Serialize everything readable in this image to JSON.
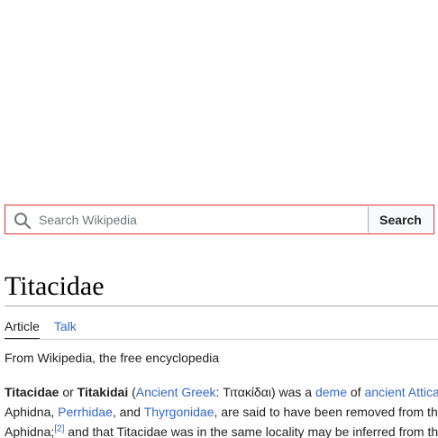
{
  "search": {
    "placeholder": "Search Wikipedia",
    "button_label": "Search"
  },
  "article": {
    "title": "Titacidae",
    "tabs": [
      {
        "label": "Article",
        "active": true
      },
      {
        "label": "Talk",
        "active": false
      }
    ],
    "tagline": "From Wikipedia, the free encyclopedia",
    "line1": {
      "term1": "Titacidae",
      "or": " or ",
      "term2": "Titakidai",
      "open_paren": " (",
      "link_greek": "Ancient Greek",
      "greek_text": ": Τιτακίδαι) was a ",
      "link_deme": "deme",
      "of_text": " of ",
      "link_attica": "ancient Attica"
    },
    "line2": {
      "aphidna_text": "Aphidna, ",
      "link_perrhidae": "Perrhidae",
      "and_text": ", and ",
      "link_thyrgonidae": "Thyrgonidae",
      "rest_text": ", are said to have been removed from the"
    },
    "line3": {
      "aphidna_text": "Aphidna;",
      "ref": "[2]",
      "rest_text": " and that Titacidae was in the same locality may be inferred from the"
    }
  },
  "colors": {
    "link": "#3366cc",
    "search_border": "#dd3333",
    "text": "#202122"
  }
}
